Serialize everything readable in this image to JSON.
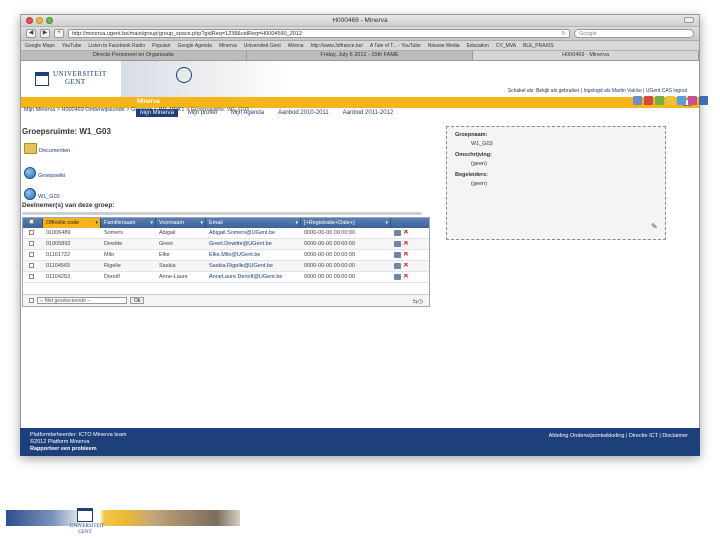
{
  "window": {
    "title": "H000469 - Minerva",
    "url": "http://minerva.ugent.be/main/group/group_space.php?gidReq=1238&cidReq=H0004590_2012",
    "search_placeholder": "Google"
  },
  "bookmarks": [
    "Google Maps",
    "YouTube",
    "Listen to Facebook Radio",
    "Populair",
    "Google Agenda",
    "Minerva",
    "Universiteit Gent",
    "Athena",
    "http://www.3dfrance.be/",
    "A Tale of T... - YouTube",
    "Nieuwe Media",
    "Education",
    "CV_MVA",
    "BLE_PRAXIS"
  ],
  "tabs": [
    {
      "label": "Directe Personeel en Organisatie"
    },
    {
      "label": "Friday, July 6 2012 - 15th FAME"
    },
    {
      "label": "H000469 - Minerva",
      "active": true
    }
  ],
  "header": {
    "logo_line1": "UNIVERSITEIT",
    "logo_line2": "GENT",
    "user_prefix": "Minerva ingelogd als:",
    "user_name": "Martin Valcke",
    "user_links": "Ingelogd als Martin Valcke | UGent CAS logout",
    "switch_text": "Schakel als: Bekijk als gebruiker"
  },
  "site_name": "Minerva",
  "nav": [
    {
      "label": "Mijn Minerva",
      "active": true
    },
    {
      "label": "Mijn profiel"
    },
    {
      "label": "Mijn Agenda"
    },
    {
      "label": "Aanbod 2010-2011"
    },
    {
      "label": "Aanbod 2011-2012"
    }
  ],
  "breadcrumb": [
    "Mijn Minerva",
    "H000469 Onderwijskunde",
    "Groepen",
    "W1_PRK1",
    "Groepsruimte: W1_G03"
  ],
  "page_title": "Groepsruimte: W1_G03",
  "links": [
    {
      "label": "Documenten",
      "icon": "folder-icon"
    },
    {
      "label": "Groepswiki",
      "icon": "globe-icon"
    },
    {
      "label": "W1_G03",
      "icon": "globe-icon"
    }
  ],
  "info": {
    "group_label": "Groepnaam:",
    "group_value": "W1_G03",
    "desc_label": "Omschrijving:",
    "desc_value": "(geen)",
    "tutors_label": "Begeleiders:",
    "tutors_value": "(geen)"
  },
  "members_title": "Deelnemer(s) van deze groep:",
  "table": {
    "columns": [
      "Officiële code",
      "Familienaam",
      "Voornaam",
      "Email",
      "[+Registratie+Date+]"
    ],
    "rows": [
      [
        "01006489",
        "Somers",
        "Abigail",
        "Abigail.Somers@UGent.be",
        "0000-00-00 00:00:00"
      ],
      [
        "01005892",
        "Dewitte",
        "Greet",
        "Greet.Dewitte@UGent.be",
        "0000-00-00 00:00:00"
      ],
      [
        "01101722",
        "Milo",
        "Elke",
        "Elke.Milo@UGent.be",
        "0000-00-00 00:00:00"
      ],
      [
        "01104565",
        "Rigelle",
        "Saskia",
        "Saskia.Rigelle@UGent.be",
        "0000-00-00 00:00:00"
      ],
      [
        "01104253",
        "Denolf",
        "Anne-Laure",
        "AnneLaure.Denolf@UGent.be",
        "0000-00-00 00:00:00"
      ]
    ],
    "bulk_select": "-- Met geselecteerde --",
    "ok_label": "Ok"
  },
  "footer": {
    "line1": "Platformbeheerder: ICTO Minerva team",
    "line2": "©2012 Platform Minerva",
    "line3": "Rapporteer een probleem",
    "links": "Afdeling Onderwijsontwikkeling | Directie ICT | Disclaimer"
  },
  "deck_logo": {
    "line1": "UNIVERSITEIT",
    "line2": "GENT"
  }
}
